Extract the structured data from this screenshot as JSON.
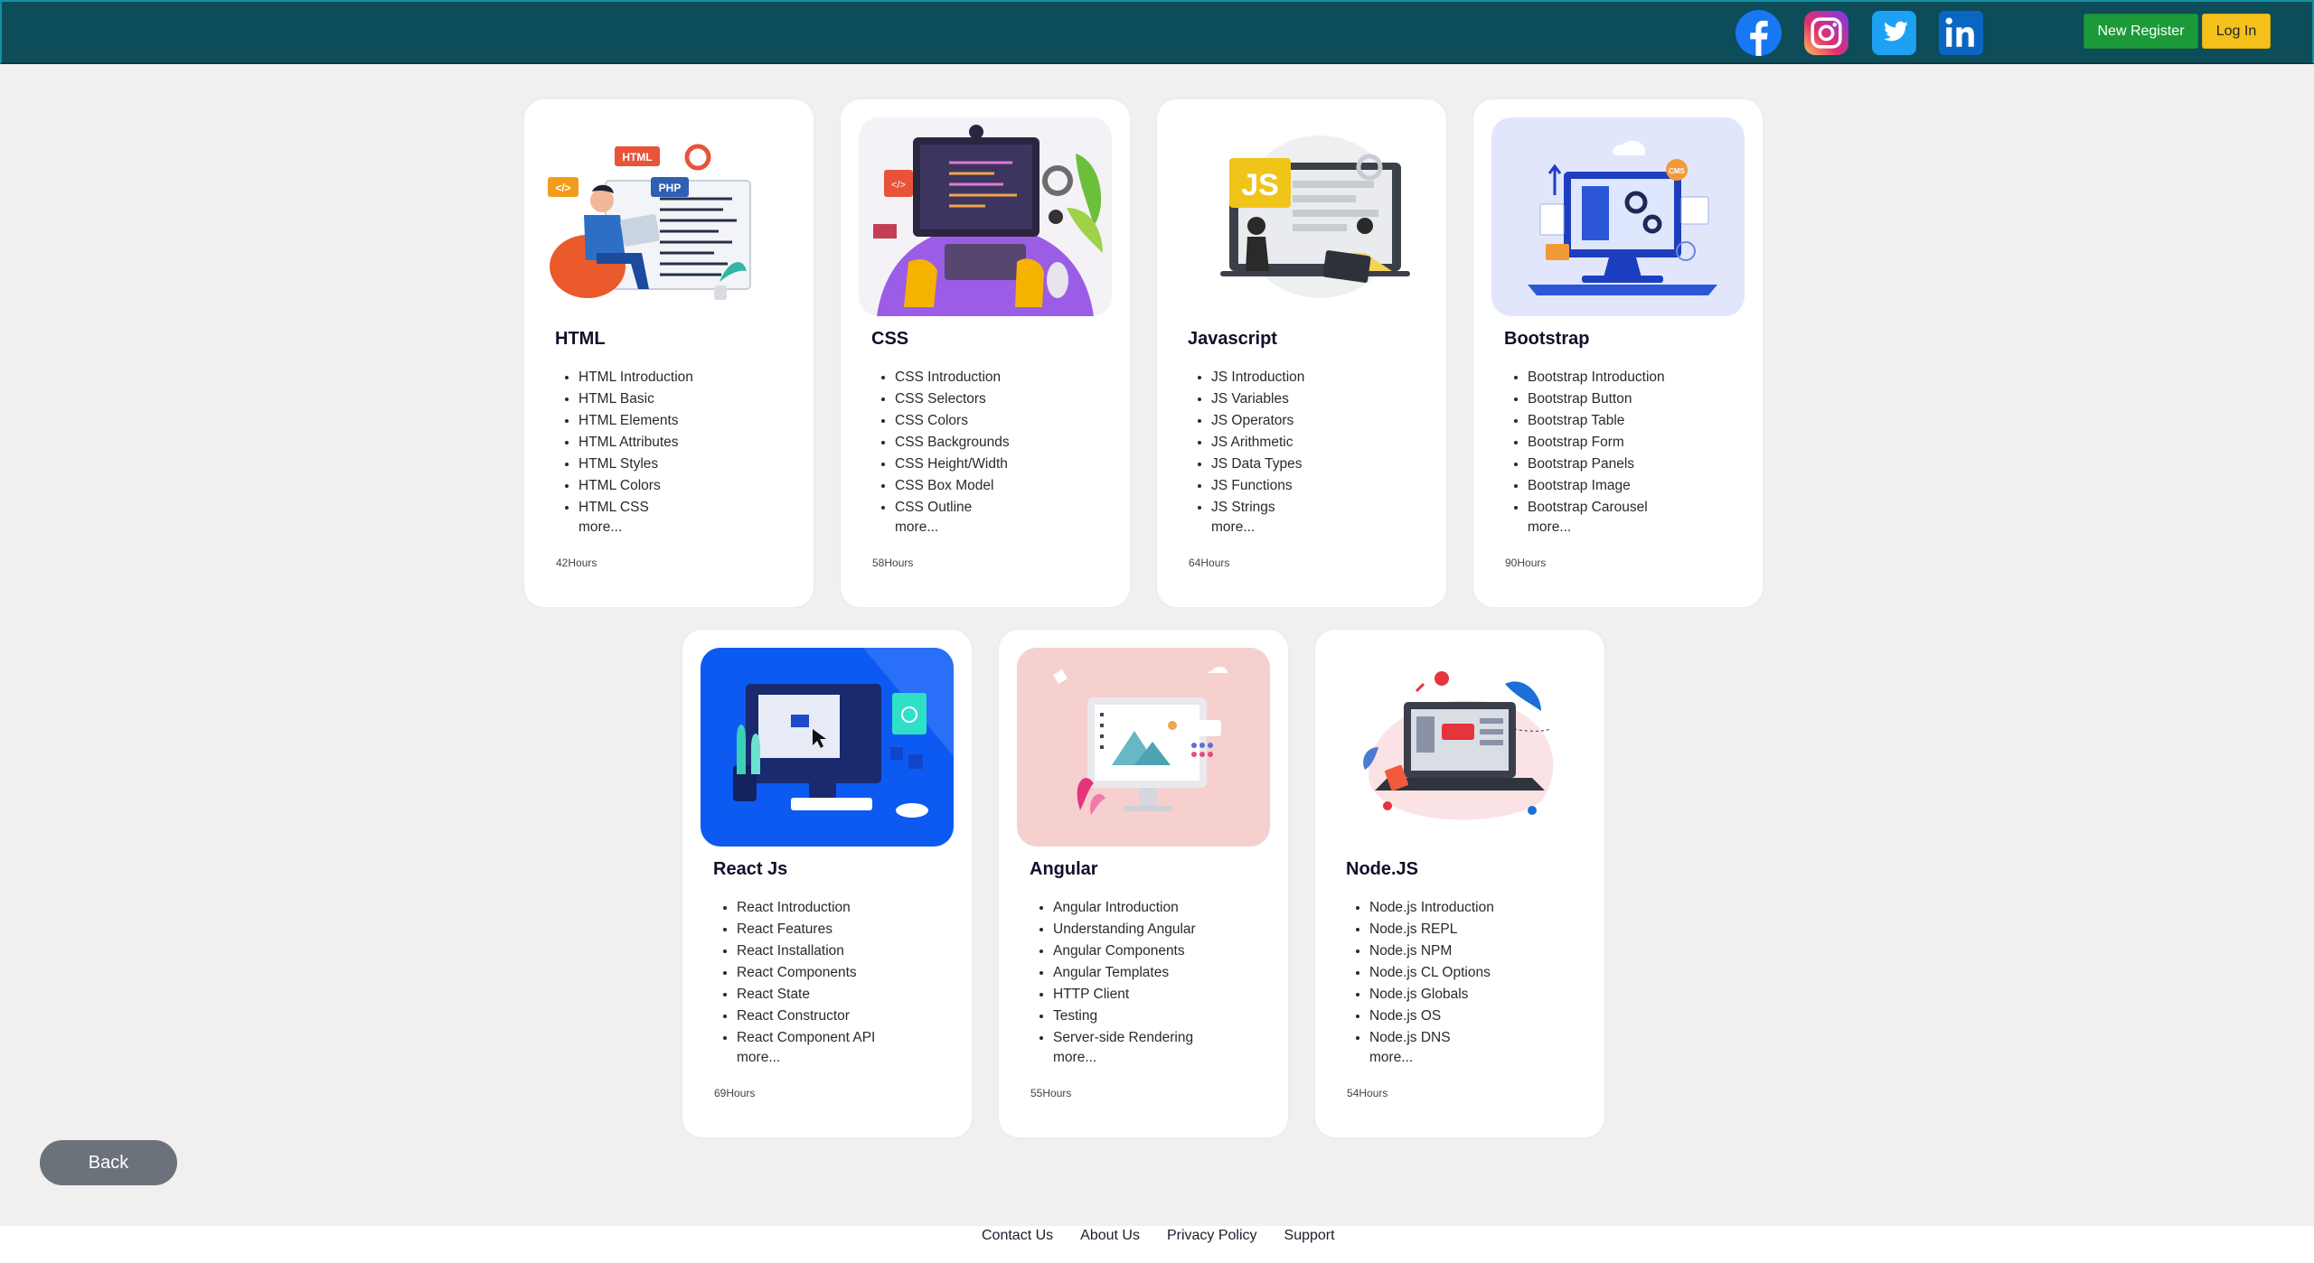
{
  "header": {
    "social": [
      "facebook-icon",
      "instagram-icon",
      "twitter-icon",
      "linkedin-icon"
    ],
    "register_label": "New Register",
    "login_label": "Log In"
  },
  "courses": [
    {
      "title": "HTML",
      "topics": [
        "HTML Introduction",
        "HTML Basic",
        "HTML Elements",
        "HTML Attributes",
        "HTML Styles",
        "HTML Colors",
        "HTML CSS"
      ],
      "more": "more...",
      "hours": "42Hours"
    },
    {
      "title": "CSS",
      "topics": [
        "CSS Introduction",
        "CSS Selectors",
        "CSS Colors",
        "CSS Backgrounds",
        "CSS Height/Width",
        "CSS Box Model",
        "CSS Outline"
      ],
      "more": "more...",
      "hours": "58Hours"
    },
    {
      "title": "Javascript",
      "topics": [
        "JS Introduction",
        "JS Variables",
        "JS Operators",
        "JS Arithmetic",
        "JS Data Types",
        "JS Functions",
        "JS Strings"
      ],
      "more": "more...",
      "hours": "64Hours"
    },
    {
      "title": "Bootstrap",
      "topics": [
        "Bootstrap Introduction",
        "Bootstrap Button",
        "Bootstrap Table",
        "Bootstrap Form",
        "Bootstrap Panels",
        "Bootstrap Image",
        "Bootstrap Carousel"
      ],
      "more": "more...",
      "hours": "90Hours"
    },
    {
      "title": "React Js",
      "topics": [
        "React Introduction",
        "React Features",
        "React Installation",
        "React Components",
        "React State",
        "React Constructor",
        "React Component API"
      ],
      "more": "more...",
      "hours": "69Hours"
    },
    {
      "title": "Angular",
      "topics": [
        "Angular Introduction",
        "Understanding Angular",
        "Angular Components",
        "Angular Templates",
        "HTTP Client",
        "Testing",
        "Server-side Rendering"
      ],
      "more": "more...",
      "hours": "55Hours"
    },
    {
      "title": "Node.JS",
      "topics": [
        "Node.js Introduction",
        "Node.js REPL",
        "Node.js NPM",
        "Node.js CL Options",
        "Node.js Globals",
        "Node.js OS",
        "Node.js DNS"
      ],
      "more": "more...",
      "hours": "54Hours"
    }
  ],
  "illustrations": {
    "html_badge": "HTML",
    "php_badge": "PHP",
    "js_badge": "JS",
    "cms_badge": "CMS"
  },
  "back_label": "Back",
  "footer": [
    "Contact Us",
    "About Us",
    "Privacy Policy",
    "Support"
  ],
  "colors": {
    "header": "#0d4c59",
    "register": "#1c9a39",
    "login": "#f4c11a",
    "back": "#6c727a"
  }
}
